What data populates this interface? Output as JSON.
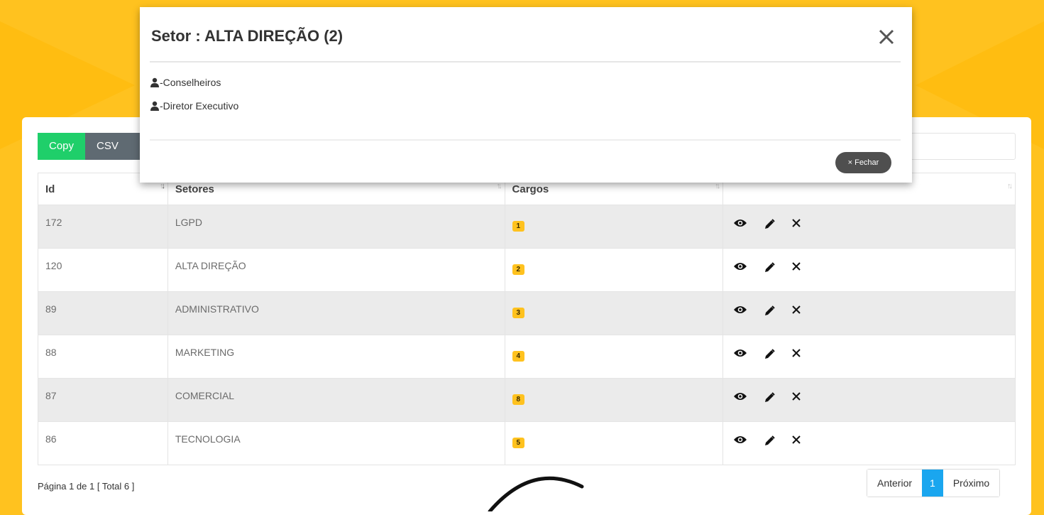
{
  "toolbar": {
    "copy_label": "Copy",
    "csv_label": "CSV"
  },
  "table": {
    "headers": [
      "Id",
      "Setores",
      "Cargos",
      ""
    ],
    "rows": [
      {
        "id": "172",
        "setor": "LGPD",
        "cargos": "1"
      },
      {
        "id": "120",
        "setor": "ALTA DIREÇÃO",
        "cargos": "2"
      },
      {
        "id": "89",
        "setor": "ADMINISTRATIVO",
        "cargos": "3"
      },
      {
        "id": "88",
        "setor": "MARKETING",
        "cargos": "4"
      },
      {
        "id": "87",
        "setor": "COMERCIAL",
        "cargos": "8"
      },
      {
        "id": "86",
        "setor": "TECNOLOGIA",
        "cargos": "5"
      }
    ]
  },
  "footer": {
    "info": "Página 1 de 1 [ Total 6 ]"
  },
  "pager": {
    "prev": "Anterior",
    "current": "1",
    "next": "Próximo"
  },
  "modal": {
    "title": "Setor : ALTA DIREÇÃO (2)",
    "items": [
      "-Conselheiros",
      "-Diretor Executivo"
    ],
    "close_label": "Fechar",
    "close_glyph": "×"
  },
  "colors": {
    "background": "#ffc21f",
    "copy": "#1fcf6a",
    "csv": "#5f6a72",
    "active_page": "#1aa6ef",
    "badge": "#ffc21f"
  },
  "icons": {
    "view": "eye-icon",
    "edit": "pencil-icon",
    "delete": "close-icon",
    "person": "user-icon"
  }
}
